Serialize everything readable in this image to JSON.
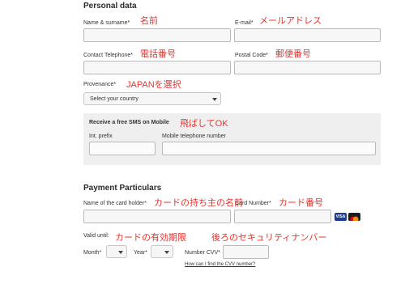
{
  "personal": {
    "title": "Personal data",
    "name_label": "Name & surname*",
    "name_note": "名前",
    "email_label": "E-mail*",
    "email_note": "メールアドレス",
    "phone_label": "Contact Telephone*",
    "phone_note": "電話番号",
    "postal_label": "Postal Code*",
    "postal_note": "郵便番号",
    "provenance_label": "Provenance*",
    "provenance_note": "JAPANを選択",
    "country_select": "Select your country"
  },
  "sms": {
    "title": "Receive a free SMS on Mobile",
    "note": "飛ばしてOK",
    "prefix_label": "Int. prefix",
    "mobile_label": "Mobile telephone number"
  },
  "payment": {
    "title": "Payment Particulars",
    "holder_label": "Name of the card holder*",
    "holder_note": "カードの持ち主の名前",
    "card_label": "Card Number*",
    "card_note": "カード番号",
    "valid_label": "Valid until:",
    "valid_note": "カードの有効期限",
    "cvv_note": "後ろのセキュリティナンバー",
    "month_label": "Month*",
    "year_label": "Year*",
    "cvv_label": "Number CVV*",
    "cvv_link": "How can I find the CVV number?",
    "card_brands": [
      "VISA",
      "MasterCard"
    ]
  }
}
